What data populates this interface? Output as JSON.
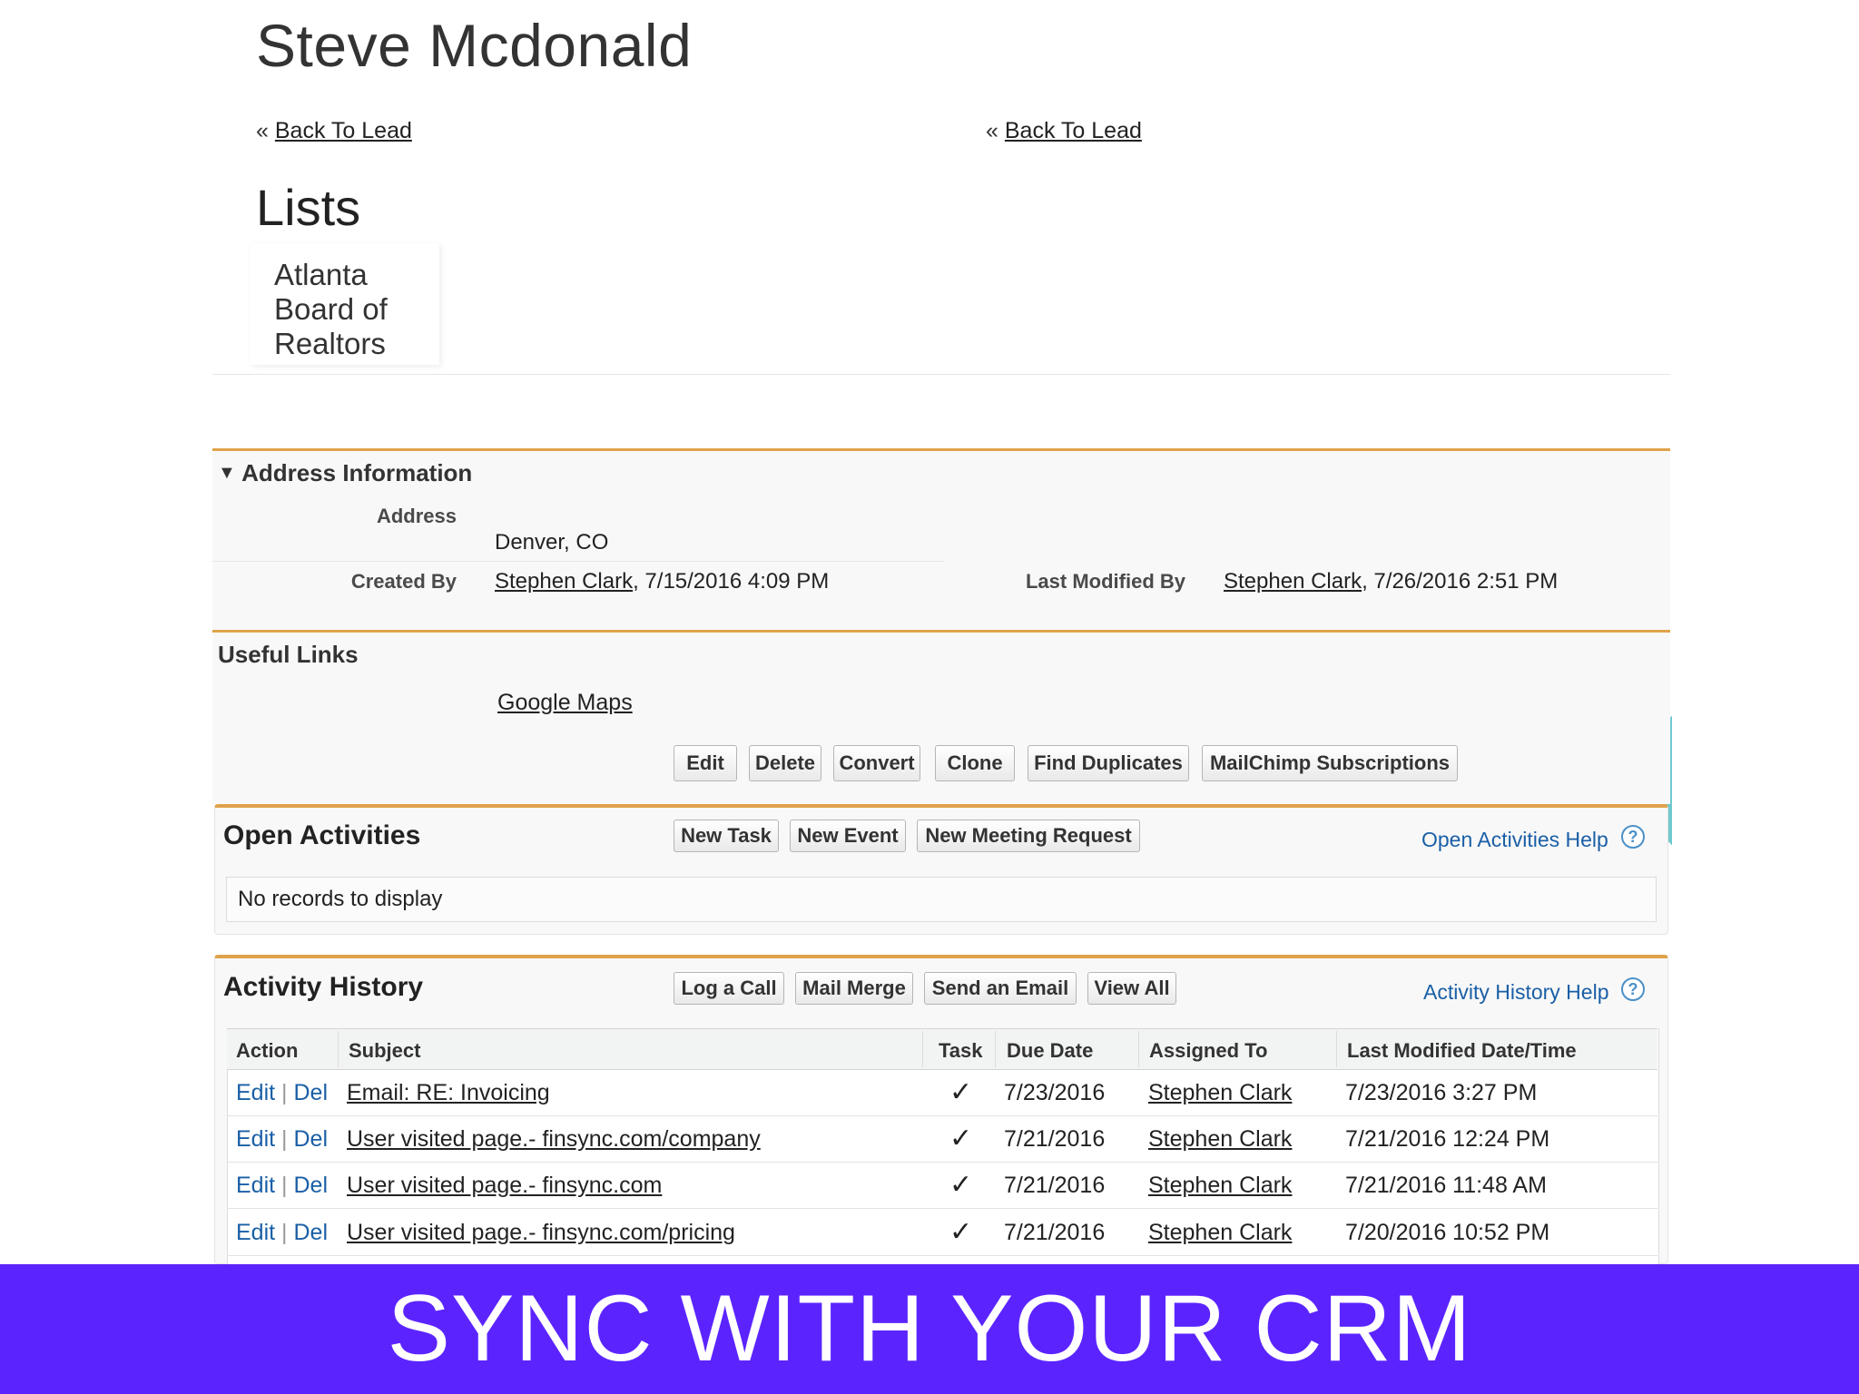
{
  "header": {
    "title": "Steve Mcdonald",
    "back_prefix": "«",
    "back_link": "Back To Lead"
  },
  "lists": {
    "title": "Lists",
    "items": [
      "Atlanta Board of Realtors"
    ]
  },
  "address_section": {
    "title": "Address Information",
    "address_label": "Address",
    "address_value": "Denver, CO",
    "created_by_label": "Created By",
    "created_by_name": "Stephen Clark",
    "created_by_date": ", 7/15/2016 4:09 PM",
    "last_modified_label": "Last Modified By",
    "last_modified_name": "Stephen Clark",
    "last_modified_date": ", 7/26/2016 2:51 PM"
  },
  "useful_links": {
    "title": "Useful Links",
    "google_maps": "Google Maps"
  },
  "record_buttons": [
    "Edit",
    "Delete",
    "Convert",
    "Clone",
    "Find Duplicates",
    "MailChimp Subscriptions"
  ],
  "open_activities": {
    "title": "Open Activities",
    "buttons": [
      "New Task",
      "New Event",
      "New Meeting Request"
    ],
    "help": "Open Activities Help",
    "empty": "No records to display"
  },
  "activity_history": {
    "title": "Activity History",
    "buttons": [
      "Log a Call",
      "Mail Merge",
      "Send an Email",
      "View All"
    ],
    "help": "Activity History Help",
    "columns": [
      "Action",
      "Subject",
      "Task",
      "Due Date",
      "Assigned To",
      "Last Modified Date/Time"
    ],
    "edit": "Edit",
    "sep": "|",
    "del": "Del",
    "check": "✓",
    "rows": [
      {
        "subject": "Email: RE: Invoicing",
        "due": "7/23/2016",
        "assigned": "Stephen Clark",
        "modified": "7/23/2016 3:27 PM"
      },
      {
        "subject": "User visited page.- finsync.com/company",
        "due": "7/21/2016",
        "assigned": "Stephen Clark",
        "modified": "7/21/2016 12:24 PM"
      },
      {
        "subject": "User visited page.- finsync.com",
        "due": "7/21/2016",
        "assigned": "Stephen Clark",
        "modified": "7/21/2016 11:48 AM"
      },
      {
        "subject": "User visited page.- finsync.com/pricing",
        "due": "7/21/2016",
        "assigned": "Stephen Clark",
        "modified": "7/20/2016 10:52 PM"
      }
    ]
  },
  "banner": {
    "text": "SYNC WITH YOUR CRM",
    "color": "#5b24ff"
  },
  "colors": {
    "section_rule": "#e0a24b",
    "link_blue": "#1a5fa6",
    "accent_teal": "#6fc9cf"
  }
}
